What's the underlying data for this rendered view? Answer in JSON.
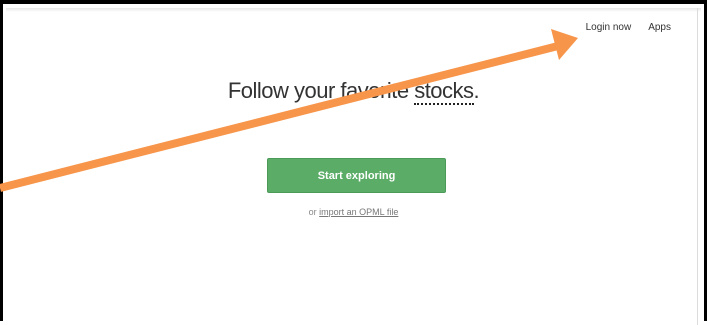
{
  "nav": {
    "login_label": "Login now",
    "apps_label": "Apps"
  },
  "hero": {
    "headline_prefix": "Follow your favorite ",
    "headline_topic": "stocks",
    "headline_suffix": ".",
    "cta_label": "Start exploring",
    "import_prefix": "or ",
    "import_link": "import an OPML file"
  },
  "annotation": {
    "color": "#f7954a",
    "shape": "arrow"
  },
  "colors": {
    "cta_background": "#5aac67",
    "frame_border": "#000000"
  }
}
